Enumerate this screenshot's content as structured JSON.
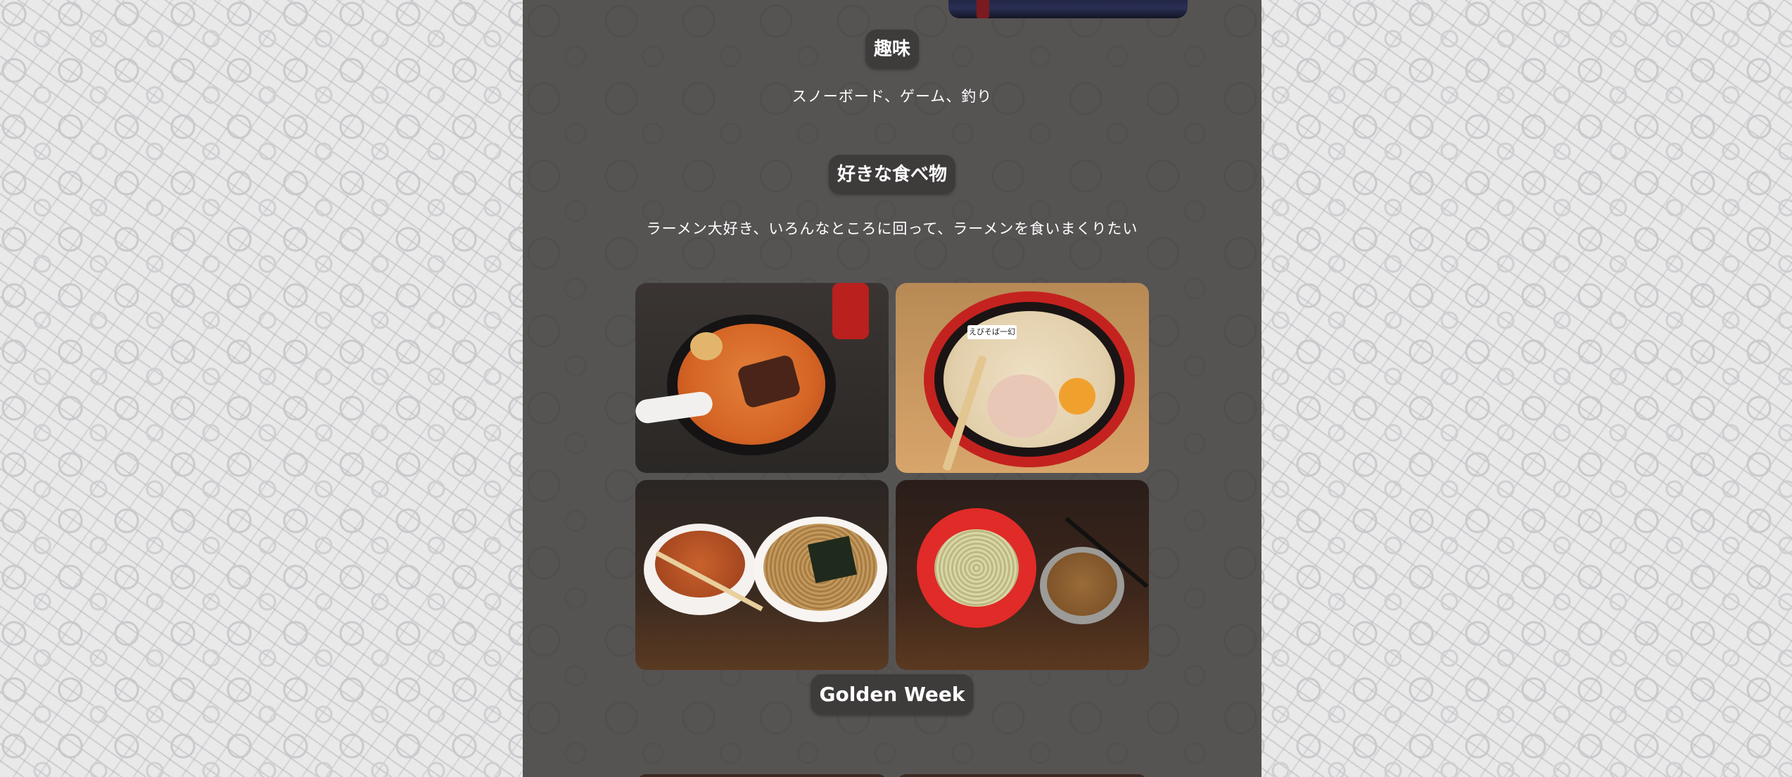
{
  "sections": {
    "hobby": {
      "title": "趣味",
      "text": "スノーボード、ゲーム、釣り"
    },
    "food": {
      "title": "好きな食べ物",
      "text": "ラーメン大好き、いろんなところに回って、ラーメンを食いまくりたい",
      "photos": [
        {
          "name": "spicy-miso-ramen-photo"
        },
        {
          "name": "shrimp-ramen-photo",
          "tag": "えびそば一幻"
        },
        {
          "name": "tsukemen-photo"
        },
        {
          "name": "tsukemen-chashu-photo"
        }
      ]
    },
    "golden_week": {
      "title": "Golden Week"
    }
  },
  "colors": {
    "page_background": "#e9e9ea",
    "column_background": "#565353",
    "pill_background": "#3e3b3b",
    "text": "#ffffff"
  }
}
